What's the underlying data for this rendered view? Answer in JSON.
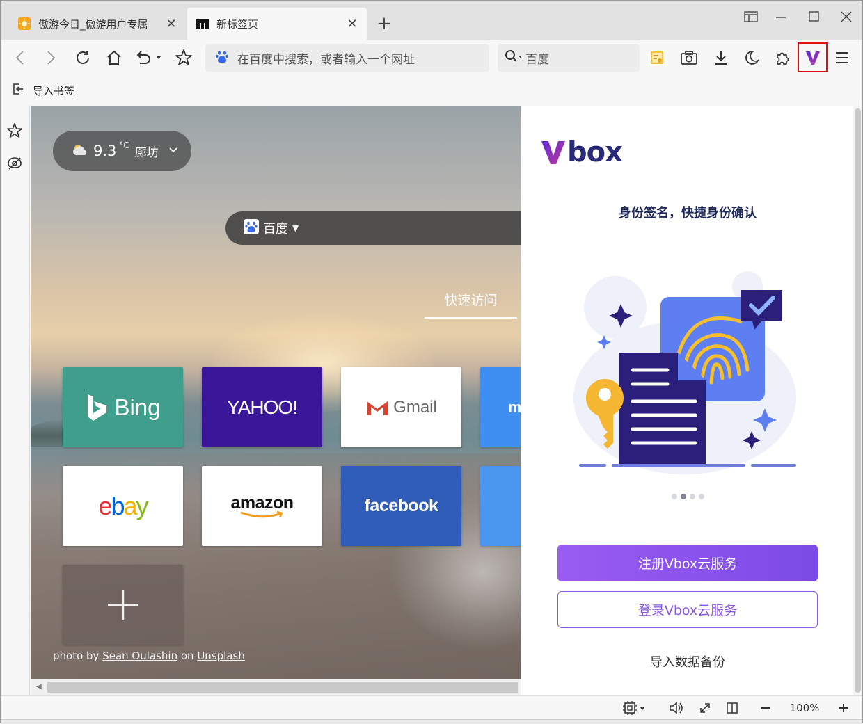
{
  "tabs": [
    {
      "title": "傲游今日_傲游用户专属",
      "active": false
    },
    {
      "title": "新标签页",
      "active": true
    }
  ],
  "toolbar": {
    "address_placeholder": "在百度中搜索，或者输入一个网址",
    "search_engine": "百度"
  },
  "bookmarks_bar": {
    "import_label": "导入书签"
  },
  "newtab": {
    "weather": {
      "temperature": "9.3",
      "unit": "°C",
      "city": "廊坊"
    },
    "search_engine": "百度",
    "quick_access_tab": "快速访问",
    "tiles": [
      {
        "name": "bing",
        "label": "Bing",
        "bg": "#3f9e8c"
      },
      {
        "name": "yahoo",
        "label": "YAHOO!",
        "bg": "#3a1798"
      },
      {
        "name": "gmail",
        "label": "Gmail",
        "bg": "#ffffff"
      },
      {
        "name": "partial-m",
        "label": "m",
        "bg": "#3f8ef2"
      },
      {
        "name": "ebay",
        "label": "ebay",
        "bg": "#ffffff"
      },
      {
        "name": "amazon",
        "label": "amazon",
        "bg": "#ffffff"
      },
      {
        "name": "facebook",
        "label": "facebook",
        "bg": "#2f5cb8"
      },
      {
        "name": "partial-blue",
        "label": "",
        "bg": "#4a96ee"
      },
      {
        "name": "add",
        "label": "+",
        "bg": "#6e625e"
      }
    ],
    "credit": {
      "prefix": "photo by ",
      "author": "Sean Oulashin",
      "middle": " on ",
      "site": "Unsplash"
    }
  },
  "panel": {
    "brand": "box",
    "slogan": "身份签名，快捷身份确认",
    "carousel": {
      "count": 4,
      "active": 1
    },
    "register_label": "注册Vbox云服务",
    "login_label": "登录Vbox云服务",
    "import_label": "导入数据备份",
    "accent": "#8a55e8"
  },
  "statusbar": {
    "zoom": "100%"
  }
}
